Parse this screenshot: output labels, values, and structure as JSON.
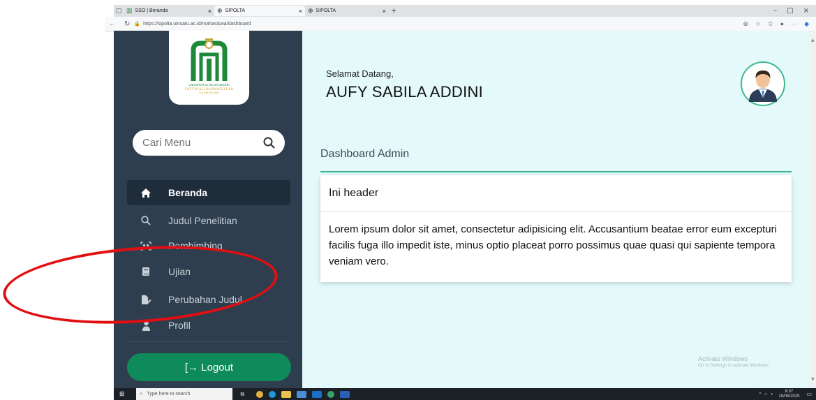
{
  "browser": {
    "tabs": [
      {
        "label": "SSO | Beranda",
        "active": false
      },
      {
        "label": "SIPOLTA",
        "active": true
      },
      {
        "label": "SIPOLTA",
        "active": false
      }
    ],
    "new_tab_symbol": "+",
    "url": "https://sipolta.uinsatu.ac.id/mahasiswa/dashboard",
    "window_controls": [
      "–",
      "□",
      "×"
    ]
  },
  "sidebar": {
    "logo": {
      "lines": [
        "UNIVERSITAS ISLAM NEGERI",
        "SAYYID ALI RAHMATULLAH",
        "TULUNGAGUNG"
      ]
    },
    "search": {
      "placeholder": "Cari Menu"
    },
    "menu": [
      {
        "label": "Beranda",
        "icon": "home-icon",
        "active": true
      },
      {
        "label": "Judul Penelitian",
        "icon": "search-icon",
        "active": false
      },
      {
        "label": "Pembimbing",
        "icon": "users-icon",
        "active": false
      },
      {
        "label": "Ujian",
        "icon": "book-icon",
        "active": false
      },
      {
        "label": "Perubahan Judul",
        "icon": "file-edit-icon",
        "active": false
      },
      {
        "label": "Profil",
        "icon": "user-icon",
        "active": false
      }
    ],
    "logout_label": "[→ Logout"
  },
  "main": {
    "greeting": "Selamat Datang,",
    "user_name": "AUFY SABILA ADDINI",
    "dashboard_title": "Dashboard Admin",
    "card": {
      "header": "Ini header",
      "body": "Lorem ipsum dolor sit amet, consectetur adipisicing elit. Accusantium beatae error eum excepturi facilis fuga illo impedit iste, minus optio placeat porro possimus quae quasi qui sapiente tempora veniam vero."
    },
    "watermark": {
      "line1": "Activate Windows",
      "line2": "Go to Settings to activate Windows."
    }
  },
  "taskbar": {
    "search_placeholder": "Type here to search",
    "time": "8:37",
    "date": "19/05/2025"
  },
  "colors": {
    "sidebar_bg": "#2e3e4e",
    "active_item_bg": "#1f2c3a",
    "main_bg": "#e4fafa",
    "accent_green": "#39b489",
    "logout_green": "#0f8a5a",
    "annotation_red": "#e20e12"
  }
}
